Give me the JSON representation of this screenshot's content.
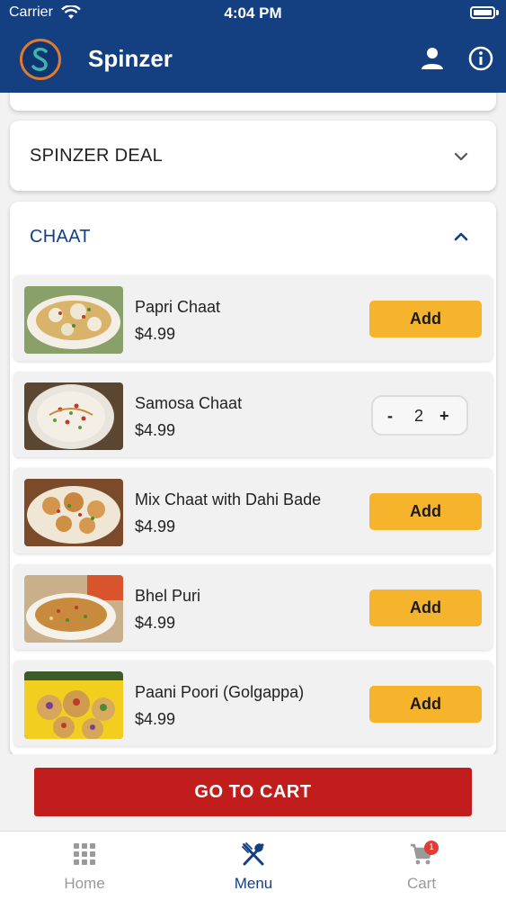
{
  "status_bar": {
    "carrier": "Carrier",
    "time": "4:04 PM"
  },
  "header": {
    "title": "Spinzer",
    "logo_letter": "S"
  },
  "sections": {
    "deal": {
      "label": "SPINZER DEAL"
    },
    "chaat": {
      "label": "CHAAT"
    }
  },
  "items": [
    {
      "name": "Papri Chaat",
      "price": "$4.99",
      "action": "Add"
    },
    {
      "name": "Samosa Chaat",
      "price": "$4.99",
      "minus": "-",
      "quantity": "2",
      "plus": "+"
    },
    {
      "name": "Mix Chaat with Dahi Bade",
      "price": "$4.99",
      "action": "Add"
    },
    {
      "name": "Bhel Puri",
      "price": "$4.99",
      "action": "Add"
    },
    {
      "name": "Paani Poori (Golgappa)",
      "price": "$4.99",
      "action": "Add"
    }
  ],
  "cart_button": {
    "label": "GO TO CART"
  },
  "tabs": [
    {
      "label": "Home",
      "icon": "grid-icon"
    },
    {
      "label": "Menu",
      "icon": "utensils-icon",
      "active": true
    },
    {
      "label": "Cart",
      "icon": "cart-icon",
      "badge": "1"
    }
  ],
  "colors": {
    "brand": "#143f80",
    "add_button": "#f6b42d",
    "cart_button": "#c21d1d",
    "badge": "#e53935"
  }
}
